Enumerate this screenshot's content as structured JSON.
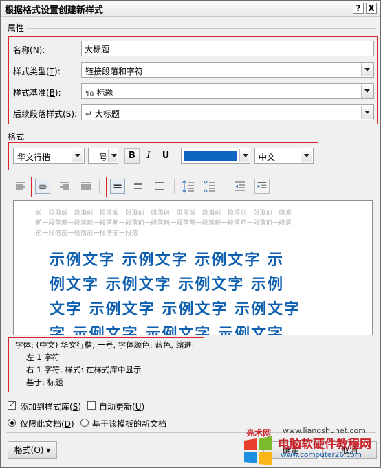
{
  "window": {
    "title": "根据格式设置创建新样式",
    "help_label": "?",
    "close_label": "X"
  },
  "properties": {
    "section_label": "属性",
    "name": {
      "label": "名称(",
      "key": "N",
      "suffix": "):",
      "value": "大标题"
    },
    "style_type": {
      "label": "样式类型(",
      "key": "T",
      "suffix": "):",
      "value": "链接段落和字符"
    },
    "based_on": {
      "label": "样式基准(",
      "key": "B",
      "suffix": "):",
      "icon": "¶a",
      "value": "标题"
    },
    "next_style": {
      "label": "后续段落样式(",
      "key": "S",
      "suffix": "):",
      "icon": "↵",
      "value": "大标题"
    }
  },
  "format": {
    "section_label": "格式",
    "font": "华文行楷",
    "size": "一号",
    "bold": "B",
    "italic": "I",
    "underline": "U",
    "color": "#0c66c2",
    "script": "中文"
  },
  "preview": {
    "prev_lines": [
      "前一段落前一段落前一段落前一段落前一段落前一段落前一段落前一段落前一段落前一段落",
      "前一段落前一段落前一段落前一段落前一段落前一段落前一段落前一段落前一段落前一段落",
      "前一段落前一段落前一段落前一段落"
    ],
    "sample_lines": [
      "示例文字  示例文字  示例文字  示",
      "例文字  示例文字  示例文字  示例",
      "文字  示例文字  示例文字  示例文字",
      "字  示例文字  示例文字  示例文字"
    ]
  },
  "description": [
    "字体: (中文) 华文行楷, 一号, 字体颜色: 蓝色, 缩进:",
    "左  1 字符",
    "右  1 字符, 样式: 在样式库中显示",
    "基于: 标题"
  ],
  "options": {
    "add_to_gallery": {
      "label": "添加到样式库(",
      "key": "S",
      "suffix": ")",
      "checked": true
    },
    "auto_update": {
      "label": "自动更新(",
      "key": "U",
      "suffix": ")",
      "checked": false
    },
    "only_this_doc": {
      "label": "仅限此文档(",
      "key": "D",
      "suffix": ")",
      "checked": true
    },
    "template_docs": {
      "label": "基于该模板的新文档",
      "checked": false
    }
  },
  "buttons": {
    "format": {
      "label": "格式(",
      "key": "O",
      "suffix": ") ▾"
    },
    "ok": "确定",
    "cancel": "取消"
  },
  "watermark": {
    "site_top": "www.liangshunet.com",
    "brand": "电脑软硬件教程网",
    "site_bottom": "www.computer26.com",
    "red_text": "亮术网"
  }
}
